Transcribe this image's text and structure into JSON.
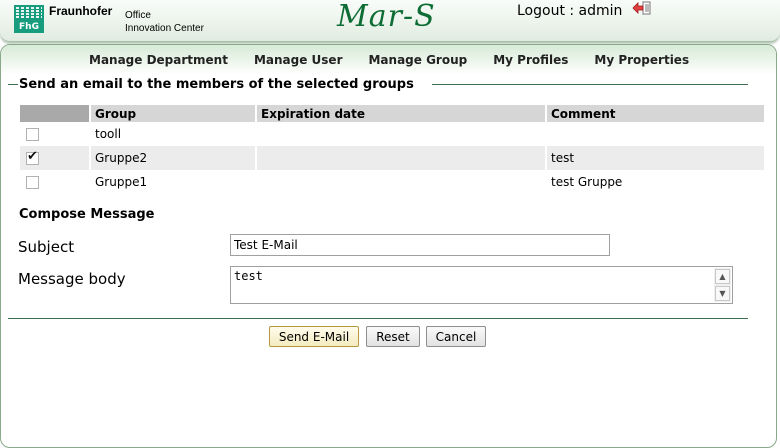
{
  "header": {
    "brand_name": "Fraunhofer",
    "brand_line1": "Office",
    "brand_line2": "Innovation Center",
    "logo_text": "FhG",
    "app_title": "Mar-S",
    "logout_text": "Logout : admin",
    "logout_icon": "logout-arrow-icon"
  },
  "nav": {
    "items": [
      "Manage Department",
      "Manage User",
      "Manage Group",
      "My Profiles",
      "My Properties"
    ]
  },
  "section": {
    "title": "Send an email to the members of the selected groups"
  },
  "table": {
    "headers": [
      "",
      "Group",
      "Expiration date",
      "Comment"
    ],
    "rows": [
      {
        "checked": false,
        "group": "tooll",
        "expiration": "",
        "comment": ""
      },
      {
        "checked": true,
        "group": "Gruppe2",
        "expiration": "",
        "comment": "test"
      },
      {
        "checked": false,
        "group": "Gruppe1",
        "expiration": "",
        "comment": "test Gruppe"
      }
    ]
  },
  "compose": {
    "heading": "Compose Message",
    "subject_label": "Subject",
    "subject_value": "Test E-Mail",
    "body_label": "Message body",
    "body_value": "test"
  },
  "buttons": {
    "send": "Send E-Mail",
    "reset": "Reset",
    "cancel": "Cancel"
  },
  "colors": {
    "brand_green": "#179c7d",
    "title_green": "#0e6d35",
    "line_green": "#3d6c4f"
  }
}
